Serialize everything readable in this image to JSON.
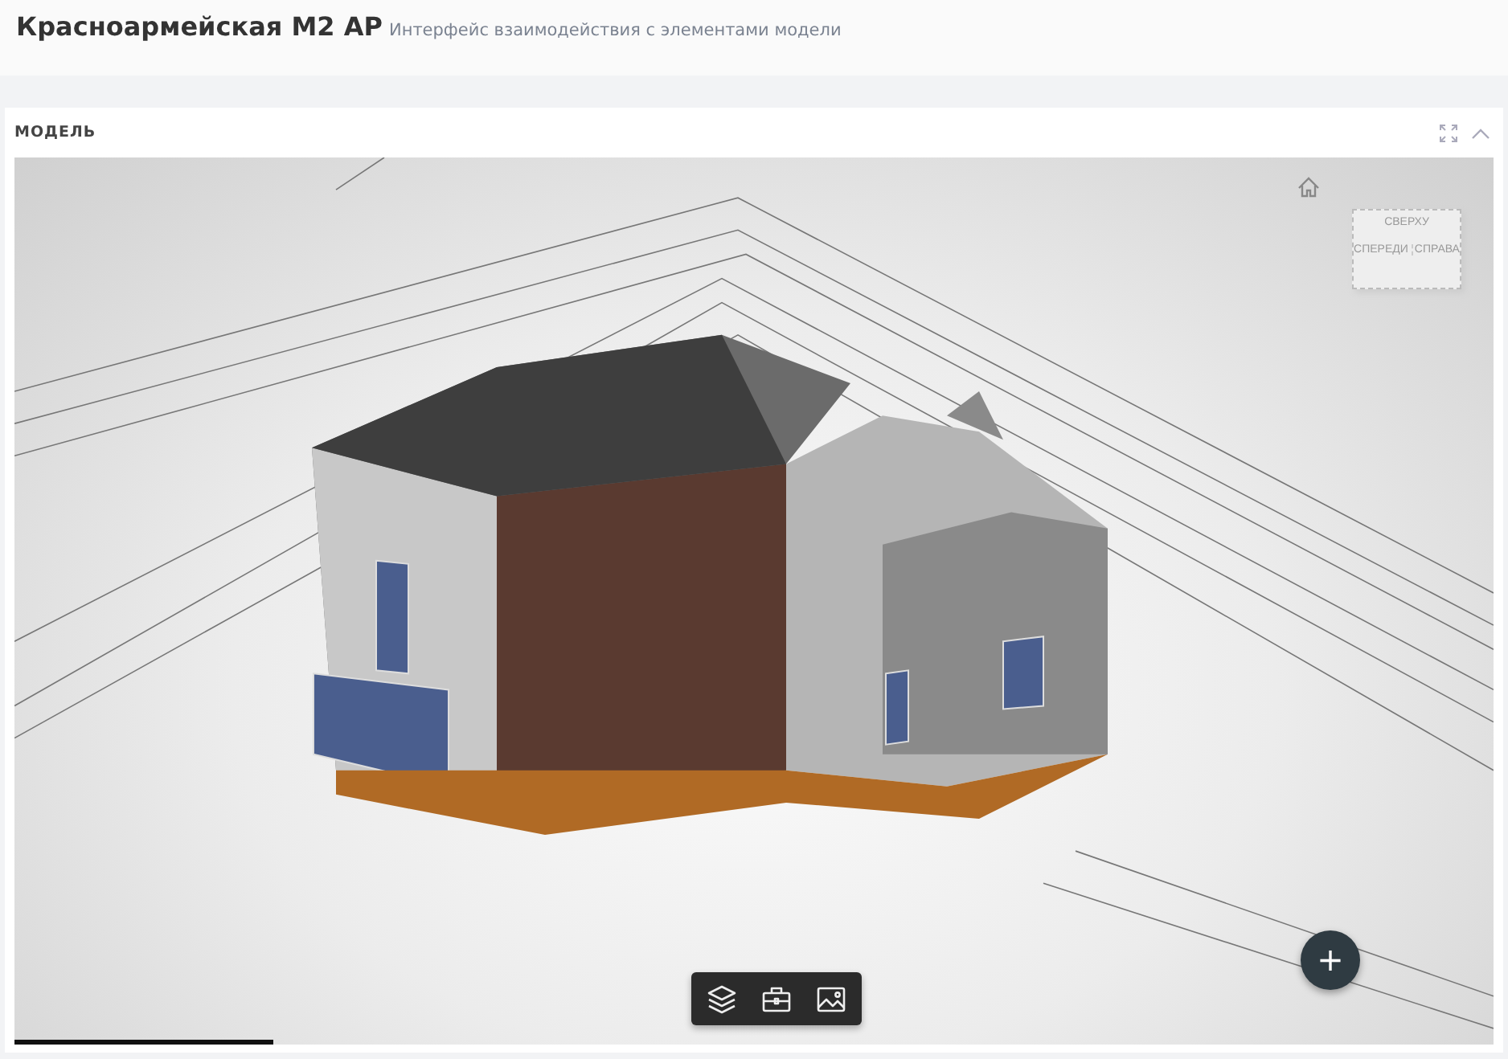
{
  "header": {
    "title": "Красноармейская М2 АР",
    "subtitle": "Интерфейс взаимодействия с элементами модели"
  },
  "panel": {
    "title": "МОДЕЛЬ",
    "expanded": true
  },
  "viewer": {
    "view_cube": {
      "top": "СВЕРХУ",
      "front": "СПЕРЕДИ",
      "right": "СПРАВА"
    },
    "toolbar": [
      {
        "kind": "layers"
      },
      {
        "kind": "toolbox"
      },
      {
        "kind": "image"
      }
    ],
    "add_button": "+",
    "loading": {
      "level": 0.175
    }
  }
}
